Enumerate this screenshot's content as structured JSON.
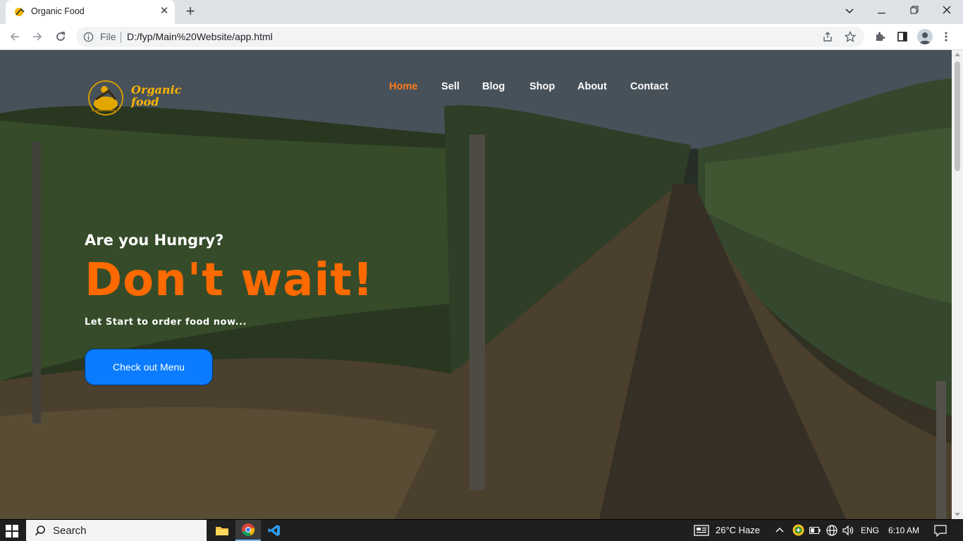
{
  "browser": {
    "tab_title": "Organic Food",
    "tab_close": "✕",
    "new_tab": "+",
    "omnibox_scheme": "File",
    "omnibox_url": "D:/fyp/Main%20Website/app.html",
    "window_controls": {
      "dropdown": "⌄",
      "minimize": "—",
      "restore": "❐",
      "close": "✕"
    }
  },
  "site": {
    "logo_text_line1": "Organic",
    "logo_text_line2": "food",
    "nav": [
      {
        "label": "Home",
        "active": true
      },
      {
        "label": "Sell",
        "active": false
      },
      {
        "label": "Blog",
        "active": false
      },
      {
        "label": "Shop",
        "active": false
      },
      {
        "label": "About",
        "active": false
      },
      {
        "label": "Contact",
        "active": false
      }
    ],
    "hero": {
      "subtitle": "Are you Hungry?",
      "title": "Don't wait!",
      "description": "Let Start to order food now...",
      "cta_label": "Check out Menu"
    },
    "colors": {
      "accent": "#ff6a00",
      "nav_active": "#ff7a1a",
      "button": "#0b7bff",
      "logo": "#ffb400"
    }
  },
  "taskbar": {
    "search_label": "Search",
    "weather": "26°C  Haze",
    "language": "ENG",
    "time": "6:10 AM"
  }
}
